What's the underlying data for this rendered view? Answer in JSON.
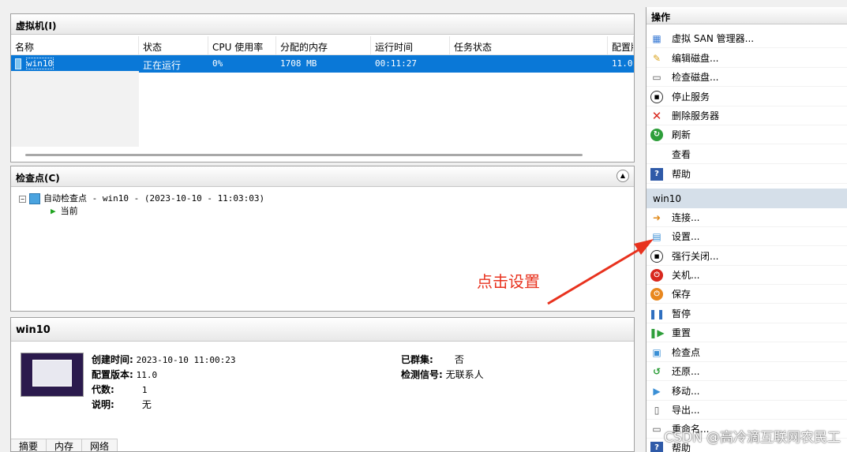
{
  "vm_panel": {
    "title": "虚拟机(I)",
    "columns": [
      "名称",
      "状态",
      "CPU 使用率",
      "分配的内存",
      "运行时间",
      "任务状态",
      "配置版"
    ],
    "rows": [
      {
        "name": "win10",
        "state": "正在运行",
        "cpu": "0%",
        "memory": "1708 MB",
        "uptime": "00:11:27",
        "task": "",
        "config": "11.0"
      }
    ]
  },
  "checkpoint_panel": {
    "title": "检查点(C)",
    "root": "自动检查点 - win10 - (2023-10-10 - 11:03:03)",
    "current": "当前"
  },
  "details_panel": {
    "title": "win10",
    "created_label": "创建时间:",
    "created_value": "2023-10-10 11:00:23",
    "config_label": "配置版本:",
    "config_value": "11.0",
    "generation_label": "代数:",
    "generation_value": "1",
    "notes_label": "说明:",
    "notes_value": "无",
    "clustered_label": "已群集:",
    "clustered_value": "否",
    "heartbeat_label": "检测信号:",
    "heartbeat_value": "无联系人",
    "tabs": [
      "摘要",
      "内存",
      "网络"
    ]
  },
  "actions": {
    "title": "操作",
    "server_items": [
      "虚拟 SAN 管理器...",
      "编辑磁盘...",
      "检查磁盘...",
      "停止服务",
      "删除服务器",
      "刷新",
      "查看",
      "帮助"
    ],
    "vm_section": "win10",
    "vm_items": [
      "连接...",
      "设置...",
      "强行关闭...",
      "关机...",
      "保存",
      "暂停",
      "重置",
      "检查点",
      "还原...",
      "移动...",
      "导出...",
      "重命名...",
      "帮助"
    ]
  },
  "annotation": "点击设置",
  "watermark": "CSDN @高冷滴互联网农民工",
  "colors": {
    "selection": "#0a78d7",
    "annotation": "#e8321e",
    "section_bg": "#d5dfe9"
  }
}
